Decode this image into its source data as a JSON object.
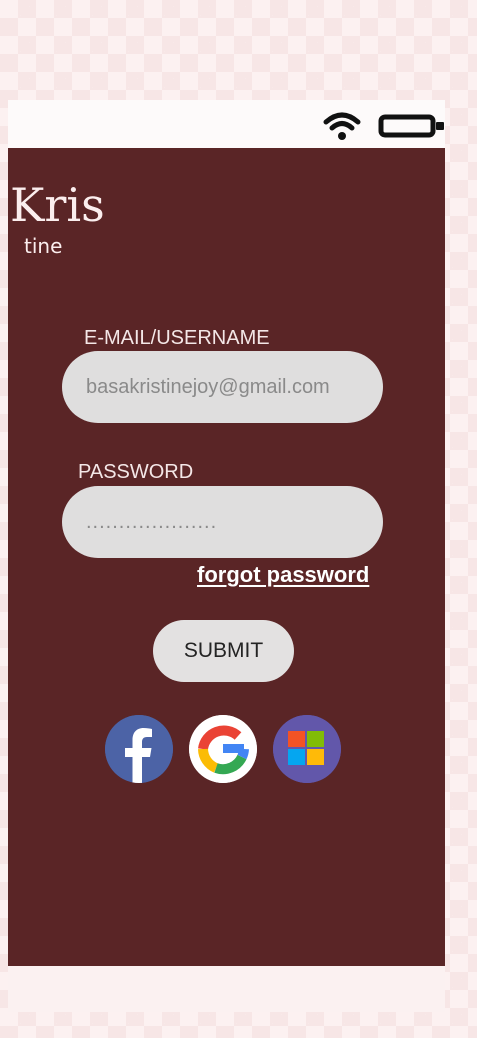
{
  "status_bar": {
    "wifi_icon": "wifi-icon",
    "battery_icon": "battery-icon"
  },
  "brand": {
    "logo_main": "Kris",
    "logo_sub": "tine"
  },
  "form": {
    "email_label": "E-MAIL/USERNAME",
    "email_value": "basakristinejoy@gmail.com",
    "password_label": "PASSWORD",
    "password_value": "....................",
    "forgot_label": "forgot password",
    "submit_label": "SUBMIT"
  },
  "social": {
    "facebook_icon": "facebook-icon",
    "google_icon": "google-icon",
    "microsoft_icon": "microsoft-icon"
  },
  "colors": {
    "screen_background": "#5a2526",
    "page_background": "#fcf1f1",
    "field_background": "#dfdede",
    "button_background": "#e3e1e1"
  }
}
